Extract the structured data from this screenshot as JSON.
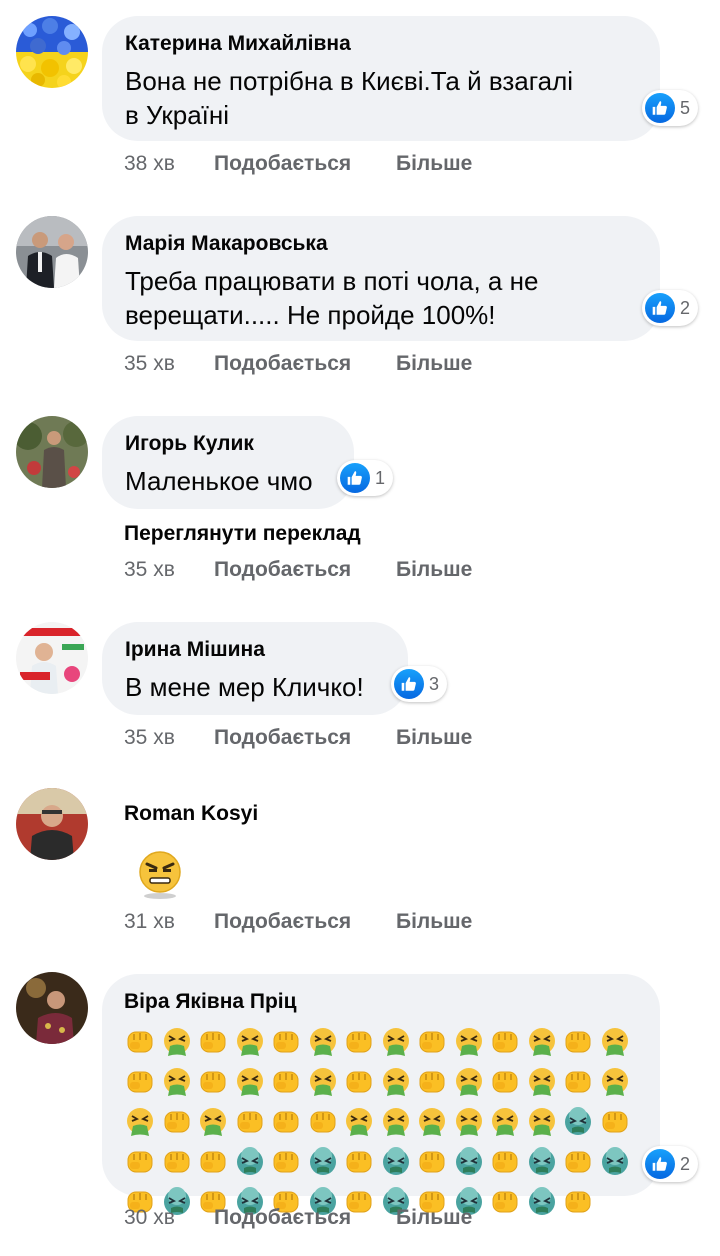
{
  "meta_labels": {
    "like": "Подобається",
    "more": "Більше"
  },
  "comments": [
    {
      "author": "Катерина Михайлівна",
      "text_line1": "Вона не потрібна в Києві.Та й взагалі",
      "text_line2": "в Україні",
      "reactions": "5",
      "time": "38 хв"
    },
    {
      "author": "Марія Макаровська",
      "text_line1": "Треба працювати в поті чола, а не",
      "text_line2": "верещати..... Не пройде 100%!",
      "reactions": "2",
      "time": "35 хв"
    },
    {
      "author": "Игорь Кулик",
      "text": "Маленькое чмо",
      "reactions": "1",
      "translate": "Переглянути переклад",
      "time": "35 хв"
    },
    {
      "author": "Ірина Мішина",
      "text": "В мене мер Кличко!",
      "reactions": "3",
      "time": "35 хв"
    },
    {
      "author": "Roman Kosyi",
      "sticker": "angry-face-emoji",
      "time": "31 хв"
    },
    {
      "author": "Віра Яківна Пріц",
      "emoji_rows": [
        "FVFVFVFVFVFVFV",
        "FVFVFVFVFVFVFVF",
        "VFVFFFVVVVVVPF",
        "FFFPFPFPFPFPFP",
        "FPFPFPFPFPFPF"
      ],
      "emoji_legend": {
        "F": "oncoming-fist-emoji",
        "V": "face-vomiting-emoji",
        "P": "nauseated-face-emoji"
      },
      "reactions": "2",
      "time": "30 хв"
    }
  ],
  "colors": {
    "like_blue": "#1877f2",
    "bubble": "#f0f2f5",
    "meta_gray": "#65676b"
  }
}
